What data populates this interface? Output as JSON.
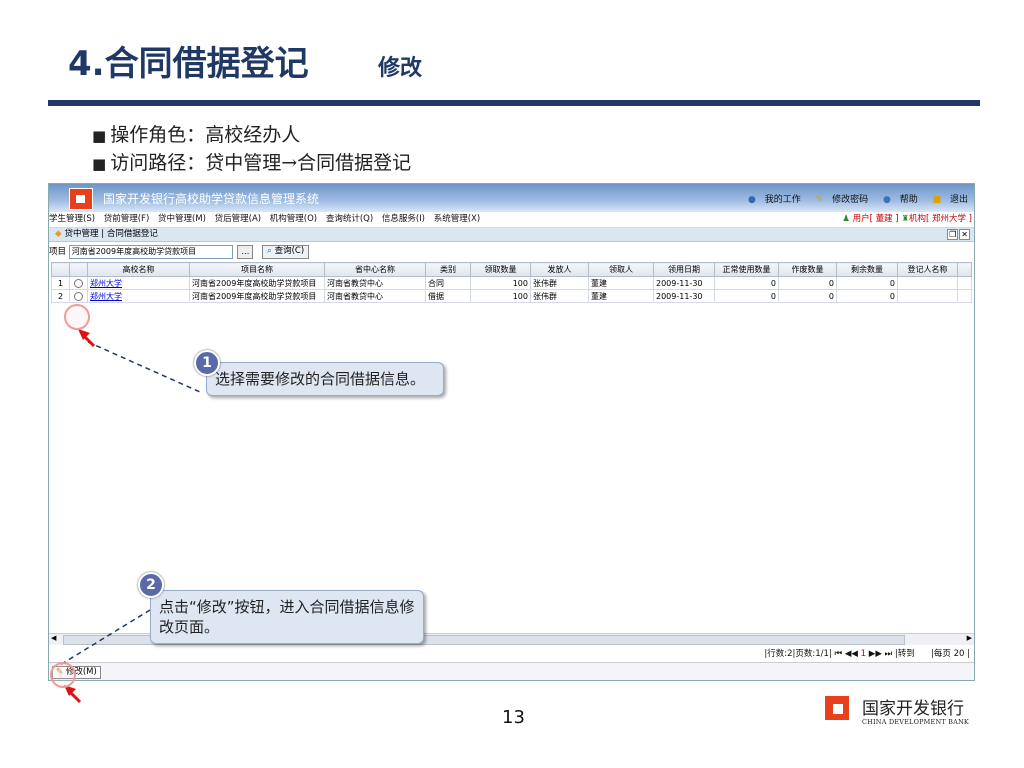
{
  "slide": {
    "title": "4.合同借据登记",
    "subtitle": "修改",
    "bullets": [
      "操作角色：高校经办人",
      "访问路径：贷中管理→合同借据登记"
    ],
    "bullet_marker": "■",
    "page_number": "13",
    "bank_name_cn": "国家开发银行",
    "bank_name_en": "CHINA DEVELOPMENT BANK"
  },
  "app": {
    "title": "国家开发银行高校助学贷款信息管理系统",
    "top_actions": [
      "我的工作",
      "修改密码",
      "帮助",
      "退出"
    ],
    "menu": [
      "学生管理(S)",
      "贷前管理(F)",
      "贷中管理(M)",
      "贷后管理(A)",
      "机构管理(O)",
      "查询统计(Q)",
      "信息服务(I)",
      "系统管理(X)"
    ],
    "user_info": "用户[ 董建 ]",
    "org_info": "机构[ 郑州大学 ]",
    "breadcrumb": "贷中管理 | 合同借据登记",
    "filter": {
      "label": "项目",
      "value": "河南省2009年度高校助学贷款项目",
      "browse_label": "…",
      "query_label": "查询(C)"
    },
    "table": {
      "columns": [
        "",
        "",
        "高校名称",
        "项目名称",
        "省中心名称",
        "类别",
        "领取数量",
        "发放人",
        "领取人",
        "领用日期",
        "正常使用数量",
        "作废数量",
        "剩余数量",
        "登记人名称"
      ],
      "rows": [
        {
          "index": "1",
          "school": "郑州大学",
          "project": "河南省2009年度高校助学贷款项目",
          "center": "河南省教贷中心",
          "type": "合同",
          "qty": "100",
          "issuer": "张伟群",
          "receiver": "董建",
          "date": "2009-11-30",
          "normal": "0",
          "void": "0",
          "remaining": "0",
          "registrar": ""
        },
        {
          "index": "2",
          "school": "郑州大学",
          "project": "河南省2009年度高校助学贷款项目",
          "center": "河南省教贷中心",
          "type": "借据",
          "qty": "100",
          "issuer": "张伟群",
          "receiver": "董建",
          "date": "2009-11-30",
          "normal": "0",
          "void": "0",
          "remaining": "0",
          "registrar": ""
        }
      ]
    },
    "pager": {
      "rows_text": "|行数:2|页数:1/1|",
      "first": "⏮",
      "prev": "◀◀",
      "current": "1",
      "next": "▶▶",
      "last": "⏭",
      "goto_label": "|转到",
      "per_page_label": "|每页",
      "per_page_value": "20"
    },
    "modify_button": "修改(M)"
  },
  "callouts": [
    {
      "badge": "1",
      "text": "选择需要修改的合同借据信息。"
    },
    {
      "badge": "2",
      "text": "点击“修改”按钮，进入合同借据信息修改页面。"
    }
  ],
  "colors": {
    "title": "#1f3864",
    "accent": "#e8401c",
    "header": "#6f95c8",
    "callout_bg": "#dde6f1"
  },
  "icons": [
    "user-icon",
    "edit-icon",
    "help-icon",
    "exit-icon",
    "pointer-arrow-icon",
    "bank-logo-icon"
  ]
}
